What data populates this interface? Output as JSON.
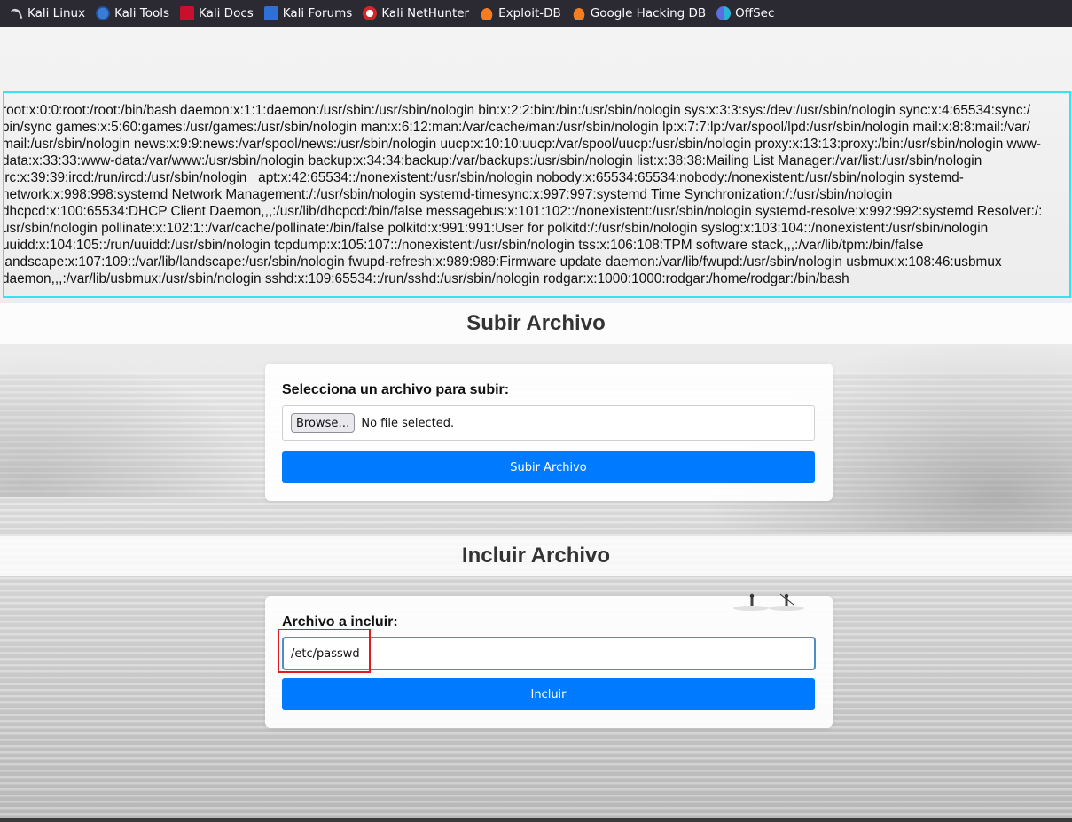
{
  "bookmarks": [
    {
      "label": "Kali Linux",
      "icon": "kali-dragon-icon"
    },
    {
      "label": "Kali Tools",
      "icon": "kali-tools-icon"
    },
    {
      "label": "Kali Docs",
      "icon": "kali-docs-icon"
    },
    {
      "label": "Kali Forums",
      "icon": "kali-forums-icon"
    },
    {
      "label": "Kali NetHunter",
      "icon": "kali-nethunter-icon"
    },
    {
      "label": "Exploit-DB",
      "icon": "exploit-db-icon"
    },
    {
      "label": "Google Hacking DB",
      "icon": "ghdb-icon"
    },
    {
      "label": "OffSec",
      "icon": "offsec-icon"
    }
  ],
  "output": {
    "lines": [
      "root:x:0:0:root:/root:/bin/bash daemon:x:1:1:daemon:/usr/sbin:/usr/sbin/nologin bin:x:2:2:bin:/bin:/usr/sbin/nologin sys:x:3:3:sys:/dev:/usr/sbin/nologin sync:x:4:65534:sync:/",
      "bin/sync games:x:5:60:games:/usr/games:/usr/sbin/nologin man:x:6:12:man:/var/cache/man:/usr/sbin/nologin lp:x:7:7:lp:/var/spool/lpd:/usr/sbin/nologin mail:x:8:8:mail:/var/",
      "mail:/usr/sbin/nologin news:x:9:9:news:/var/spool/news:/usr/sbin/nologin uucp:x:10:10:uucp:/var/spool/uucp:/usr/sbin/nologin proxy:x:13:13:proxy:/bin:/usr/sbin/nologin www-",
      "data:x:33:33:www-data:/var/www:/usr/sbin/nologin backup:x:34:34:backup:/var/backups:/usr/sbin/nologin list:x:38:38:Mailing List Manager:/var/list:/usr/sbin/nologin",
      "irc:x:39:39:ircd:/run/ircd:/usr/sbin/nologin _apt:x:42:65534::/nonexistent:/usr/sbin/nologin nobody:x:65534:65534:nobody:/nonexistent:/usr/sbin/nologin systemd-",
      "network:x:998:998:systemd Network Management:/:/usr/sbin/nologin systemd-timesync:x:997:997:systemd Time Synchronization:/:/usr/sbin/nologin",
      "dhcpcd:x:100:65534:DHCP Client Daemon,,,:/usr/lib/dhcpcd:/bin/false messagebus:x:101:102::/nonexistent:/usr/sbin/nologin systemd-resolve:x:992:992:systemd Resolver:/:",
      "usr/sbin/nologin pollinate:x:102:1::/var/cache/pollinate:/bin/false polkitd:x:991:991:User for polkitd:/:/usr/sbin/nologin syslog:x:103:104::/nonexistent:/usr/sbin/nologin",
      "uuidd:x:104:105::/run/uuidd:/usr/sbin/nologin tcpdump:x:105:107::/nonexistent:/usr/sbin/nologin tss:x:106:108:TPM software stack,,,:/var/lib/tpm:/bin/false",
      "landscape:x:107:109::/var/lib/landscape:/usr/sbin/nologin fwupd-refresh:x:989:989:Firmware update daemon:/var/lib/fwupd:/usr/sbin/nologin usbmux:x:108:46:usbmux",
      "daemon,,,:/var/lib/usbmux:/usr/sbin/nologin sshd:x:109:65534::/run/sshd:/usr/sbin/nologin rodgar:x:1000:1000:rodgar:/home/rodgar:/bin/bash"
    ]
  },
  "upload": {
    "title": "Subir Archivo",
    "label": "Selecciona un archivo para subir:",
    "browse_label": "Browse…",
    "file_status": "No file selected.",
    "submit_label": "Subir Archivo"
  },
  "include": {
    "title": "Incluir Archivo",
    "label": "Archivo a incluir:",
    "input_value": "/etc/passwd",
    "submit_label": "Incluir"
  },
  "colors": {
    "bookmarks_bg": "#2b2a33",
    "output_border": "#38e3ee",
    "primary": "#007bff",
    "highlight": "#e01b24"
  }
}
